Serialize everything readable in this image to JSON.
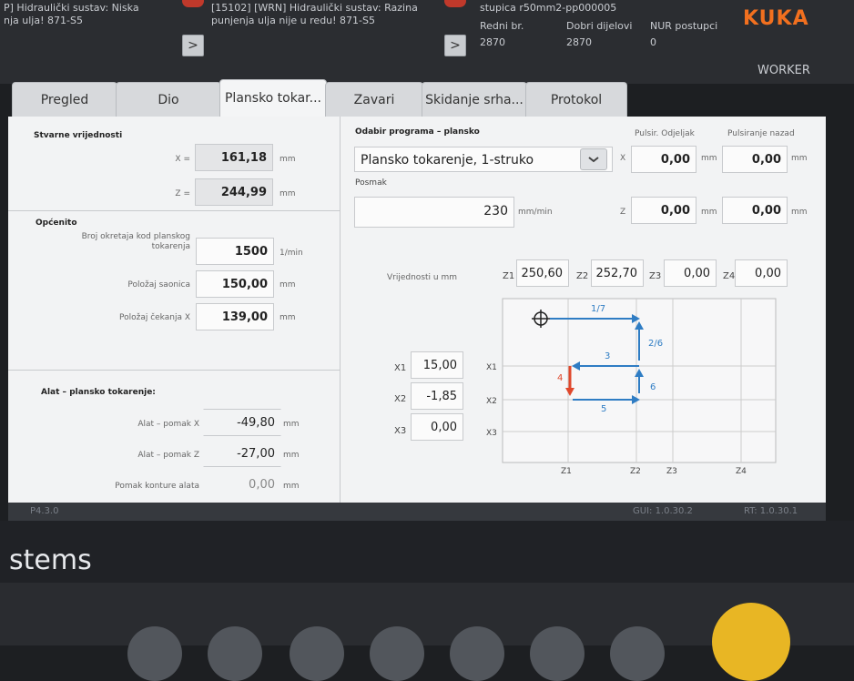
{
  "status": {
    "col1_line1": "P] Hidraulički sustav: Niska",
    "col1_line2": "nja ulja! 871-S5",
    "col2_line1": "[15102] [WRN] Hidraulički sustav: Razina",
    "col2_line2": "punjenja ulja nije u redu! 871-S5",
    "col3_line1": "stupica r50mm2-pp000005",
    "redni_label": "Redni br.",
    "redni_value": "2870",
    "dobri_label": "Dobri dijelovi",
    "dobri_value": "2870",
    "nur_label": "NUR postupci",
    "nur_value": "0",
    "arrow": ">",
    "brand": "KUKA",
    "role": "WORKER"
  },
  "tabs": [
    {
      "label": "Pregled"
    },
    {
      "label": "Dio"
    },
    {
      "label": "Plansko tokar..."
    },
    {
      "label": "Zavari"
    },
    {
      "label": "Skidanje srha..."
    },
    {
      "label": "Protokol"
    }
  ],
  "actual": {
    "title": "Stvarne vrijednosti",
    "x_label": "X =",
    "x_value": "161,18",
    "z_label": "Z =",
    "z_value": "244,99",
    "unit": "mm"
  },
  "general": {
    "title": "Općenito",
    "speed_label": "Broj okretaja kod planskog tokarenja",
    "speed_value": "1500",
    "speed_unit": "1/min",
    "slide_label": "Položaj saonica",
    "slide_value": "150,00",
    "wait_label": "Položaj čekanja X",
    "wait_value": "139,00",
    "unit": "mm"
  },
  "tool": {
    "title": "Alat – plansko tokarenje:",
    "offx_label": "Alat – pomak X",
    "offx_value": "-49,80",
    "offz_label": "Alat – pomak Z",
    "offz_value": "-27,00",
    "contour_label": "Pomak konture alata",
    "contour_value": "0,00",
    "unit": "mm"
  },
  "program": {
    "title": "Odabir programa – plansko",
    "selected": "Plansko tokarenje, 1-struko",
    "posmak_label": "Posmak",
    "posmak_value": "230",
    "posmak_unit": "mm/min",
    "pulse_fwd_label": "Pulsir. Odjeljak",
    "pulse_back_label": "Pulsiranje nazad",
    "x_label": "X",
    "z_label": "Z",
    "px_fwd": "0,00",
    "px_back": "0,00",
    "pz_fwd": "0,00",
    "pz_back": "0,00",
    "unit": "mm"
  },
  "values": {
    "label": "Vrijednosti u mm",
    "z1_label": "Z1",
    "z1": "250,60",
    "z2_label": "Z2",
    "z2": "252,70",
    "z3_label": "Z3",
    "z3": "0,00",
    "z4_label": "Z4",
    "z4": "0,00",
    "x1_label": "X1",
    "x1": "15,00",
    "x2_label": "X2",
    "x2": "-1,85",
    "x3_label": "X3",
    "x3": "0,00"
  },
  "diagram": {
    "x1": "X1",
    "x2": "X2",
    "x3": "X3",
    "z1": "Z1",
    "z2": "Z2",
    "z3": "Z3",
    "z4": "Z4",
    "s17": "1/7",
    "s26": "2/6",
    "s3": "3",
    "s4": "4",
    "s5": "5",
    "s6": "6",
    "blue": "#2f7dc4",
    "red": "#e0482c"
  },
  "footer": {
    "version": "P4.3.0",
    "gui": "GUI: 1.0.30.2",
    "rt": "RT: 1.0.30.1",
    "brand_tail": "stems"
  }
}
